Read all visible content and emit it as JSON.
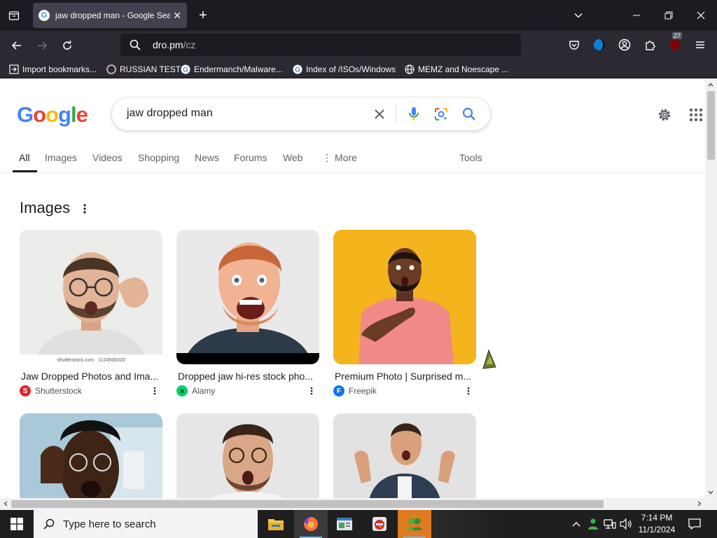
{
  "browser": {
    "tab": {
      "title": "jaw dropped man - Google Search",
      "favicon": "G"
    },
    "address": {
      "host": "dro.pm",
      "path": "/cz"
    },
    "extensions_badge": "27",
    "bookmarks": [
      {
        "label": "Import bookmarks...",
        "icon": "import-icon"
      },
      {
        "label": "RUSSIAN TEST",
        "icon": "site-favicon"
      },
      {
        "label": "Endermanch/Malware...",
        "icon": "google-favicon"
      },
      {
        "label": "Index of /ISOs/Windows",
        "icon": "google-favicon"
      },
      {
        "label": "MEMZ and Noescape ...",
        "icon": "globe-icon"
      }
    ]
  },
  "google": {
    "logo": [
      "G",
      "o",
      "o",
      "g",
      "l",
      "e"
    ],
    "logo_colors": [
      "#4285f4",
      "#ea4335",
      "#fbbc05",
      "#4285f4",
      "#34a853",
      "#ea4335"
    ],
    "query": "jaw dropped man",
    "tabs": [
      {
        "label": "All"
      },
      {
        "label": "Images"
      },
      {
        "label": "Videos"
      },
      {
        "label": "Shopping"
      },
      {
        "label": "News"
      },
      {
        "label": "Forums"
      },
      {
        "label": "Web"
      },
      {
        "label": "More"
      }
    ],
    "tools_label": "Tools",
    "images_heading": "Images",
    "results": [
      {
        "title": "Jaw Dropped Photos and Ima...",
        "source": "Shutterstock",
        "source_color": "#e52228",
        "source_icon": "S",
        "watermark": "shutterstock.com · 1124568320"
      },
      {
        "title": "Dropped jaw hi-res stock pho...",
        "source": "Alamy",
        "source_color": "#00d26a",
        "source_icon": "a"
      },
      {
        "title": "Premium Photo | Surprised m...",
        "source": "Freepik",
        "source_color": "#1273eb",
        "source_icon": "F"
      }
    ]
  },
  "taskbar": {
    "search_placeholder": "Type here to search",
    "time": "7:14 PM",
    "date": "11/1/2024"
  },
  "colors": {
    "chrome_dark": "#1c1b22",
    "chrome_mid": "#2b2a33",
    "google_blue": "#1a73e8"
  }
}
